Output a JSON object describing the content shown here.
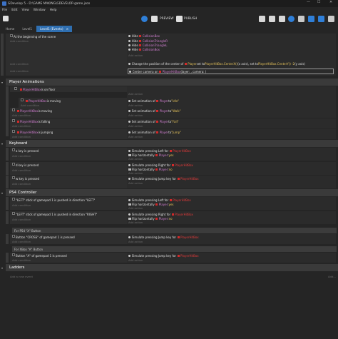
{
  "window": {
    "title": "GDevelop 5 - D:\\GAME MAKING\\GDEVELOP-game.json",
    "min_icon": "—",
    "max_icon": "☐",
    "close_icon": "✕"
  },
  "menu": [
    "File",
    "Edit",
    "View",
    "Window",
    "Help"
  ],
  "toolbar": {
    "preview_label": "PREVIEW",
    "publish_label": "PUBLISH"
  },
  "tabs": [
    {
      "label": "Home"
    },
    {
      "label": "Level1"
    },
    {
      "label": "Level1 (Events)",
      "close": "×"
    }
  ],
  "add_condition": "Add condition",
  "add_action": "Add action",
  "events": {
    "e1_cond": "At the beginning of the scene",
    "e1_actions": [
      {
        "verb": "Hide",
        "obj": "CollisionBox"
      },
      {
        "verb": "Hide",
        "obj": "CollisionTriangleR"
      },
      {
        "verb": "Hide",
        "obj": "CollisionTriangleL"
      },
      {
        "verb": "Hide",
        "obj": "CollisionBox"
      }
    ],
    "e2_action": {
      "pre": "Change the position of the center of",
      "obj": "Player",
      "mid": "set to",
      "v1": "PlayerHitBox.CenterX()",
      "mid2": "(x axis), set to",
      "v2": "PlayerHitBox.CenterY() -2",
      "post": "(y axis)"
    },
    "e3_action": {
      "pre": "Center camera on",
      "obj": "PlayerHitBox",
      "post": "(layer: , camera: )"
    }
  },
  "groups": {
    "player_anim": {
      "title": "Player Animations",
      "e1_cond": {
        "obj": "PlayerHitBox",
        "text": "is on floor"
      },
      "e2_cond": {
        "obj": "PlayerHitBox",
        "text": "is moving"
      },
      "e2_act": {
        "pre": "Set animation of",
        "obj": "Player",
        "mid": "to",
        "val": "\"idle\""
      },
      "e3_cond": {
        "obj": "PlayerHitBox",
        "text": "is moving"
      },
      "e3_act": {
        "pre": "Set animation of",
        "obj": "Player",
        "mid": "to",
        "val": "\"Walk\""
      },
      "e4_cond": {
        "obj": "PlayerHitBox",
        "text": "is falling"
      },
      "e4_act": {
        "pre": "Set animation of",
        "obj": "Player",
        "mid": "to",
        "val": "\"Fall\""
      },
      "e5_cond": {
        "obj": "PlayerHitBox",
        "text": "is jumping"
      },
      "e5_act": {
        "pre": "Set animation of",
        "obj": "Player",
        "mid": "to",
        "val": "\"Jump\""
      }
    },
    "keyboard": {
      "title": "Keyboard",
      "e1_cond": "a key is pressed",
      "e1_act1": {
        "pre": "Simulate pressing Left for",
        "obj": "PlayerHitBox"
      },
      "e1_act2": {
        "pre": "Flip horizontally",
        "obj": "Player",
        "mid": ":",
        "val": "yes"
      },
      "e2_cond": "d key is pressed",
      "e2_act1": {
        "pre": "Simulate pressing Right for",
        "obj": "PlayerHitBox"
      },
      "e2_act2": {
        "pre": "Flip horizontally",
        "obj": "Player",
        "mid": ":",
        "val": "no"
      },
      "e3_cond": "w key is pressed",
      "e3_act1": {
        "pre": "Simulate pressing Jump key for",
        "obj": "PlayerHitBox"
      }
    },
    "ps4": {
      "title": "PS4 Controller",
      "e1_cond": "\"LEFT\" stick of gamepad 1 is pushed in direction \"LEFT\"",
      "e1_act1": {
        "pre": "Simulate pressing Left for",
        "obj": "PlayerHitBox"
      },
      "e1_act2": {
        "pre": "Flip horizontally",
        "obj": "Player",
        "mid": ":",
        "val": "yes"
      },
      "e2_cond": "\"LEFT\" stick of gamepad 1 is pushed in direction \"RIGHT\"",
      "e2_act1": {
        "pre": "Simulate pressing Right for",
        "obj": "PlayerHitBox"
      },
      "e2_act2": {
        "pre": "Flip horizontally",
        "obj": "Player",
        "mid": ":",
        "val": "no"
      },
      "comment1": "For PS4 \"X\" Button",
      "e3_cond": "Button \"CROSS\" of gamepad 1 is pressed",
      "e3_act1": {
        "pre": "Simulate pressing Jump key for",
        "obj": "PlayerHitBox"
      },
      "comment2": "For XBox \"A\" Button",
      "e4_cond": "Button \"A\" of gamepad 1 is pressed",
      "e4_act1": {
        "pre": "Simulate pressing Jump key for",
        "obj": "PlayerHitBox"
      }
    },
    "ladders": {
      "title": "Ladders"
    }
  },
  "footer": {
    "add_new_event": "Add a new event",
    "add_right": "Add..."
  }
}
